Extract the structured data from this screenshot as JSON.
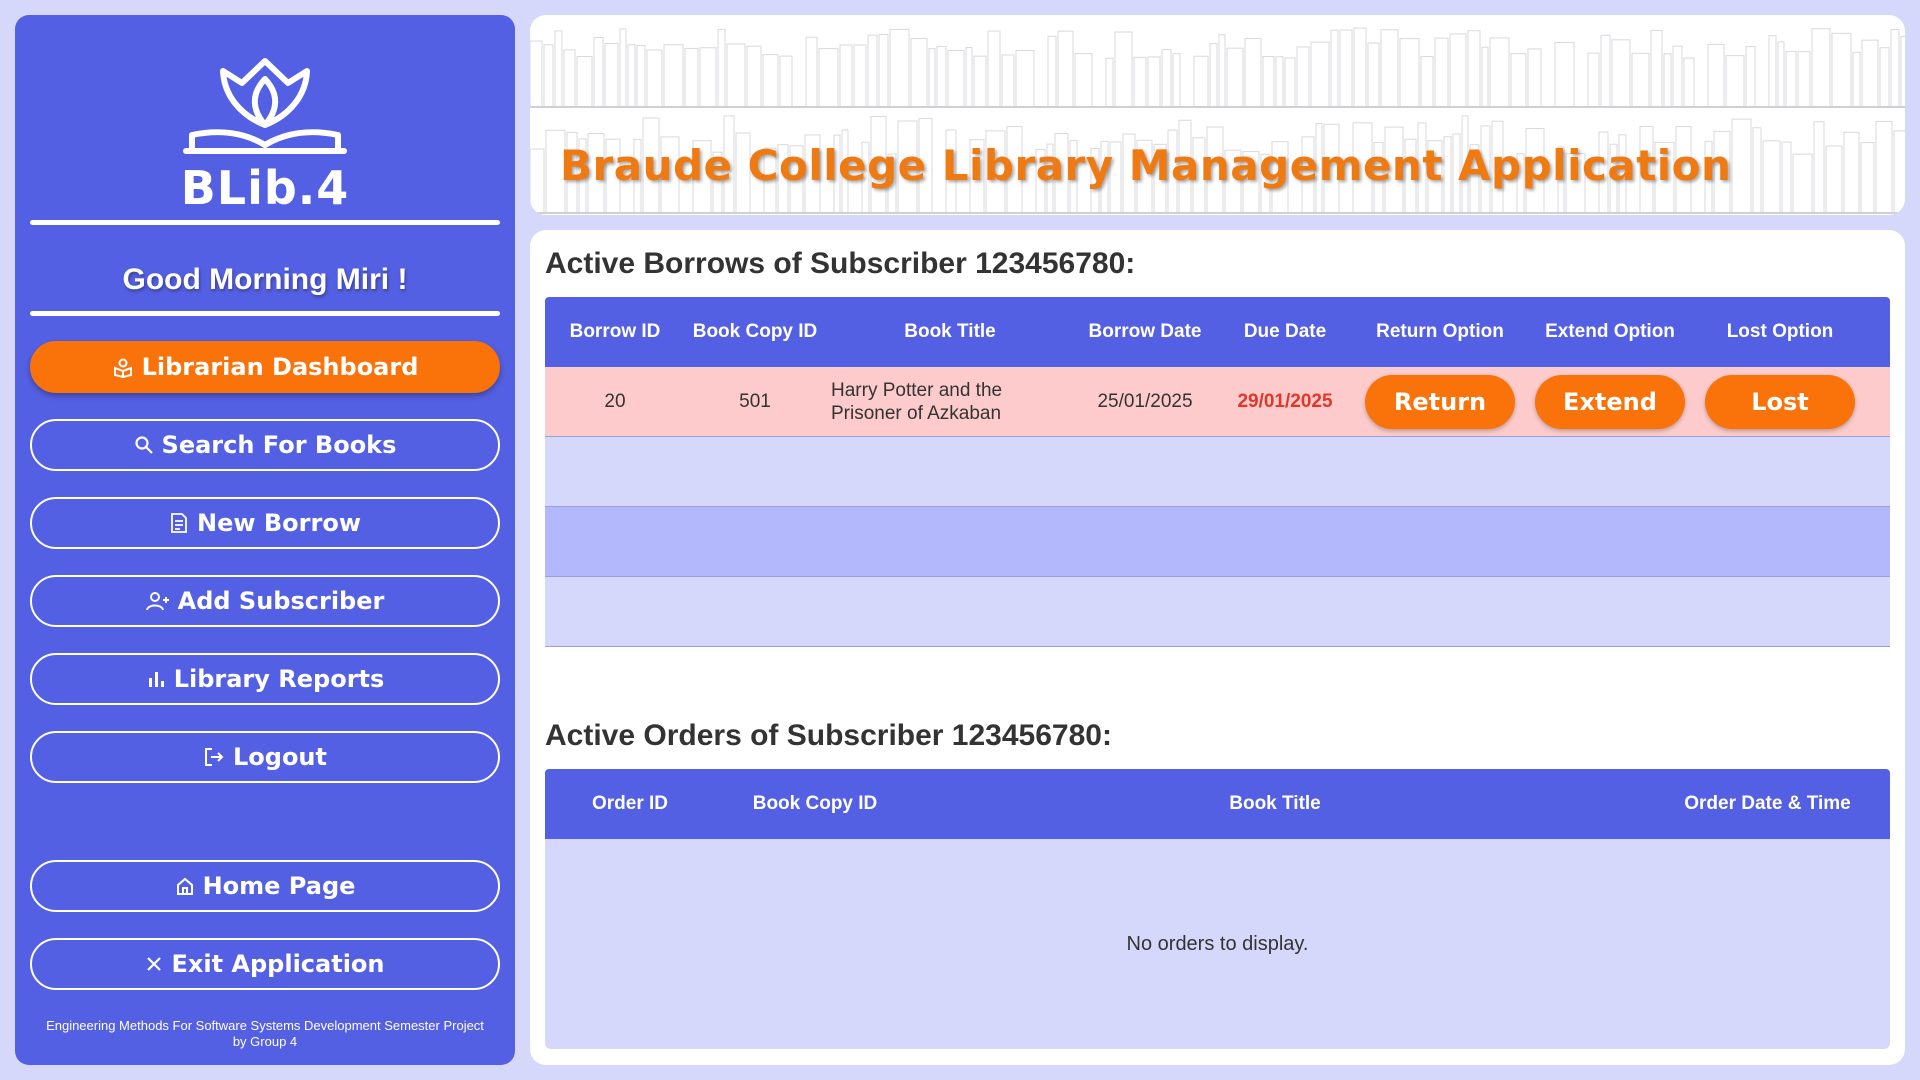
{
  "sidebar": {
    "logo_text": "BLib.4",
    "greeting": "Good Morning Miri !",
    "nav": [
      {
        "label": "Librarian Dashboard",
        "icon": "book-user-icon"
      },
      {
        "label": "Search For Books",
        "icon": "search-icon"
      },
      {
        "label": "New Borrow",
        "icon": "document-icon"
      },
      {
        "label": "Add Subscriber",
        "icon": "user-plus-icon"
      },
      {
        "label": "Library Reports",
        "icon": "bar-chart-icon"
      },
      {
        "label": "Logout",
        "icon": "logout-icon"
      }
    ],
    "bottom_nav": [
      {
        "label": "Home Page",
        "icon": "home-icon"
      },
      {
        "label": "Exit Application",
        "icon": "close-icon"
      }
    ],
    "footer_line1": "Engineering Methods For Software Systems Development Semester Project",
    "footer_line2": "by Group 4"
  },
  "banner": {
    "title": "Braude College Library Management Application"
  },
  "borrows": {
    "title": "Active Borrows of Subscriber 123456780:",
    "headers": [
      "Borrow ID",
      "Book Copy ID",
      "Book Title",
      "Borrow Date",
      "Due Date",
      "Return Option",
      "Extend Option",
      "Lost Option"
    ],
    "rows": [
      {
        "borrow_id": "20",
        "copy_id": "501",
        "title_line1": "Harry Potter and the",
        "title_line2": "Prisoner of Azkaban",
        "borrow_date": "25/01/2025",
        "due_date": "29/01/2025",
        "return_label": "Return",
        "extend_label": "Extend",
        "lost_label": "Lost"
      }
    ]
  },
  "orders": {
    "title": "Active Orders of Subscriber 123456780:",
    "headers": [
      "Order ID",
      "Book Copy ID",
      "Book Title",
      "Order Date & Time"
    ],
    "empty_message": "No orders to display."
  },
  "colors": {
    "primary": "#5460e3",
    "accent": "#f9720a",
    "background": "#d6d8fb",
    "due_date": "#e0372b"
  }
}
